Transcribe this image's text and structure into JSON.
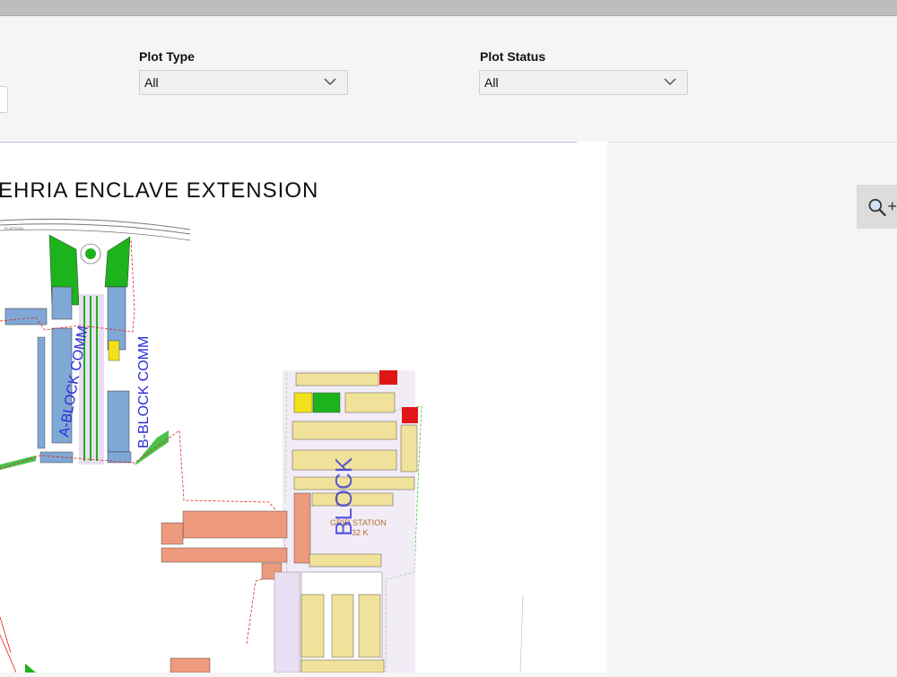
{
  "filters": {
    "plot_type": {
      "label": "Plot Type",
      "value": "All"
    },
    "plot_status": {
      "label": "Plot Status",
      "value": "All"
    }
  },
  "map": {
    "title": "EHRIA ENCLAVE EXTENSION",
    "labels": {
      "a_block": "A-BLOCK COMM",
      "b_block": "B-BLOCK COMM",
      "grid_station": "GRID STATION",
      "grid_kv": "32 K",
      "block_vertical": "BLOCK",
      "to_attock": "TO ATTOCK"
    }
  },
  "zoom": {
    "plus": "+"
  },
  "colors": {
    "green": "#1db31d",
    "commercial_blue": "#7fa8d6",
    "residential_yellow": "#f0e29a",
    "orange_plot": "#ee9a7f",
    "red_plot": "#e01616",
    "road": "#e9dff2"
  }
}
